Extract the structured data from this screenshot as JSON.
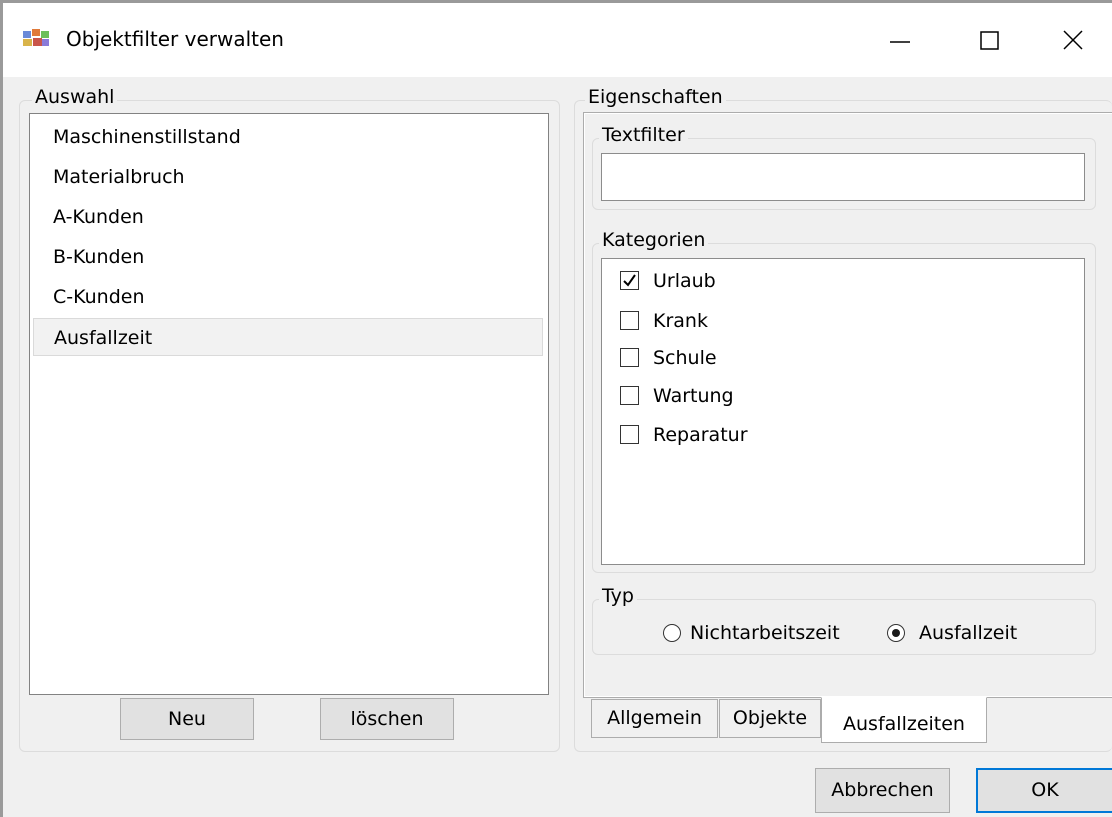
{
  "window": {
    "title": "Objektfilter verwalten"
  },
  "auswahl": {
    "legend": "Auswahl",
    "items": [
      "Maschinenstillstand",
      "Materialbruch",
      "A-Kunden",
      "B-Kunden",
      "C-Kunden",
      "Ausfallzeit"
    ],
    "selected_index": 5,
    "new_button": "Neu",
    "delete_button": "löschen"
  },
  "eigenschaften": {
    "legend": "Eigenschaften",
    "textfilter": {
      "legend": "Textfilter",
      "value": ""
    },
    "kategorien": {
      "legend": "Kategorien",
      "items": [
        {
          "label": "Urlaub",
          "checked": true
        },
        {
          "label": "Krank",
          "checked": false
        },
        {
          "label": "Schule",
          "checked": false
        },
        {
          "label": "Wartung",
          "checked": false
        },
        {
          "label": "Reparatur",
          "checked": false
        }
      ]
    },
    "typ": {
      "legend": "Typ",
      "options": [
        "Nichtarbeitszeit",
        "Ausfallzeit"
      ],
      "selected": "Ausfallzeit"
    },
    "tabs": [
      "Allgemein",
      "Objekte",
      "Ausfallzeiten"
    ],
    "active_tab": "Ausfallzeiten"
  },
  "footer": {
    "cancel_button": "Abbrechen",
    "ok_button": "OK"
  },
  "colors": {
    "window_bg": "#f0f0f0",
    "titlebar_bg": "#ffffff",
    "ok_border": "#0078d7"
  }
}
